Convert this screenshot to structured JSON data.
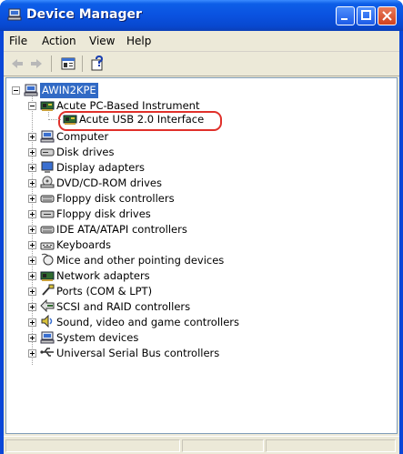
{
  "window": {
    "title": "Device Manager"
  },
  "menu": [
    "File",
    "Action",
    "View",
    "Help"
  ],
  "tree": {
    "root": "AWIN2KPE",
    "acute_group": "Acute PC-Based Instrument",
    "acute_child": "Acute USB 2.0 Interface",
    "categories": [
      "Computer",
      "Disk drives",
      "Display adapters",
      "DVD/CD-ROM drives",
      "Floppy disk controllers",
      "Floppy disk drives",
      "IDE ATA/ATAPI controllers",
      "Keyboards",
      "Mice and other pointing devices",
      "Network adapters",
      "Ports (COM & LPT)",
      "SCSI and RAID controllers",
      "Sound, video and game controllers",
      "System devices",
      "Universal Serial Bus controllers"
    ]
  },
  "colors": {
    "titlebar": "#0a52e0",
    "selection": "#316ac5",
    "highlight": "#e0302a"
  }
}
